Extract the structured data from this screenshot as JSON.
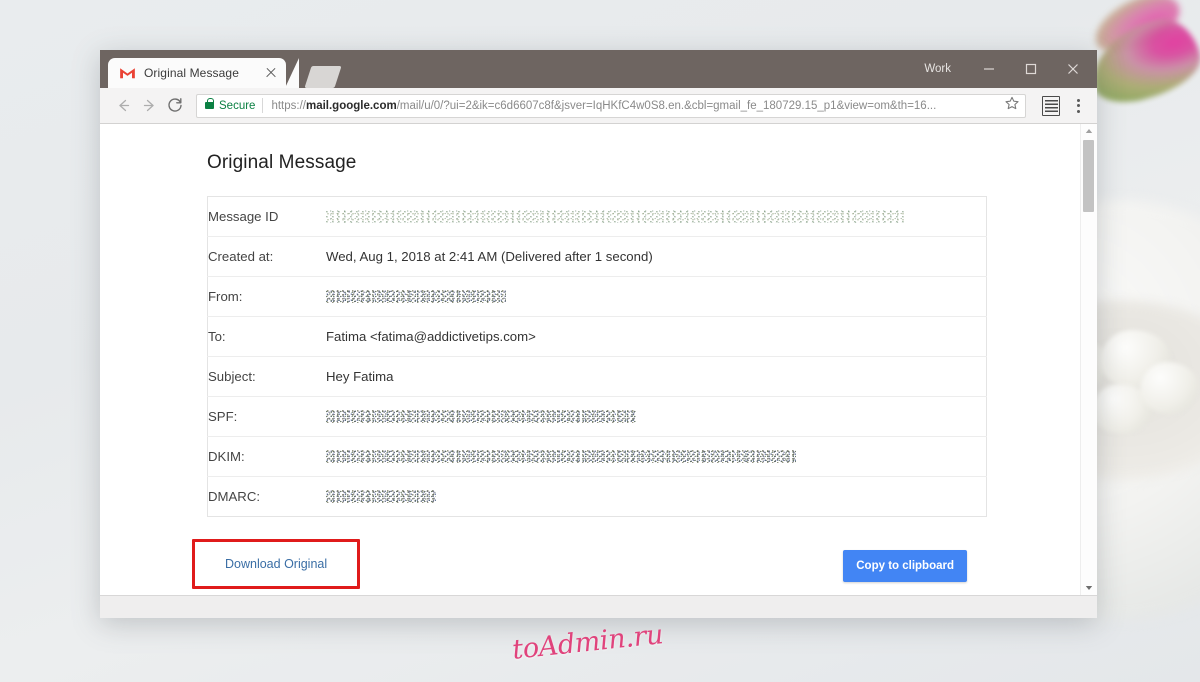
{
  "browser": {
    "tab": {
      "favicon": "gmail-m-icon",
      "title": "Original Message",
      "close_label": "×"
    },
    "new_tab_label": "",
    "profile_label": "Work",
    "window_controls": {
      "minimize": "minimize-icon",
      "maximize": "maximize-icon",
      "close": "close-icon"
    },
    "toolbar": {
      "back": "back-arrow-icon",
      "forward": "forward-arrow-icon",
      "reload": "reload-icon",
      "security_label": "Secure",
      "url_prefix": "https://",
      "url_host": "mail.google.com",
      "url_path": "/mail/u/0/?ui=2&ik=c6d6607c8f&jsver=IqHKfC4w0S8.en.&cbl=gmail_fe_180729.15_p1&view=om&th=16...",
      "bookmark": "star-icon",
      "extension": "extension-icon",
      "menu": "more-vertical-icon"
    }
  },
  "page": {
    "title": "Original Message",
    "rows": [
      {
        "label": "Message ID",
        "value": "",
        "redacted": true,
        "redact_width": 578,
        "redact_style": "green"
      },
      {
        "label": "Created at:",
        "value": "Wed, Aug 1, 2018 at 2:41 AM (Delivered after 1 second)",
        "redacted": false,
        "redact_width": 0,
        "redact_style": ""
      },
      {
        "label": "From:",
        "value": "",
        "redacted": true,
        "redact_width": 180,
        "redact_style": "dark"
      },
      {
        "label": "To:",
        "value": "Fatima <fatima@addictivetips.com>",
        "redacted": false,
        "redact_width": 0,
        "redact_style": ""
      },
      {
        "label": "Subject:",
        "value": "Hey Fatima",
        "redacted": false,
        "redact_width": 0,
        "redact_style": ""
      },
      {
        "label": "SPF:",
        "value": "",
        "redacted": true,
        "redact_width": 310,
        "redact_style": "dark"
      },
      {
        "label": "DKIM:",
        "value": "",
        "redacted": true,
        "redact_width": 470,
        "redact_style": "dark"
      },
      {
        "label": "DMARC:",
        "value": "",
        "redacted": true,
        "redact_width": 110,
        "redact_style": "dark"
      }
    ],
    "download_link": "Download Original",
    "copy_button": "Copy to clipboard",
    "scrollbar": {
      "up_arrow": "caret-up-icon",
      "down_arrow": "caret-down-icon"
    }
  },
  "annotation": {
    "highlight_color": "#e01b1b"
  },
  "watermark": {
    "text": "toAdmin.ru",
    "color": "#e0437c"
  }
}
